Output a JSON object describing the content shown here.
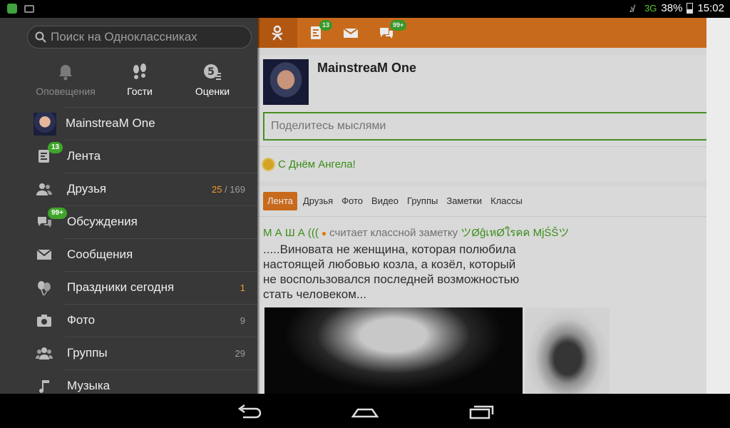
{
  "status_bar": {
    "network": "3G",
    "battery": "38%",
    "time": "15:02",
    "colors": {
      "network": "#5fc634"
    }
  },
  "drawer": {
    "search": {
      "placeholder": "Поиск на Одноклассниках"
    },
    "quick_actions": [
      {
        "label": "Оповещения",
        "icon": "bell-icon",
        "dimmed": true
      },
      {
        "label": "Гости",
        "icon": "footprints-icon",
        "dimmed": false
      },
      {
        "label": "Оценки",
        "icon": "ratings-icon",
        "dimmed": false
      }
    ],
    "items": [
      {
        "label": "MainstreaM One",
        "icon": "avatar"
      },
      {
        "label": "Лента",
        "icon": "feed-icon",
        "badge": "13"
      },
      {
        "label": "Друзья",
        "icon": "friends-icon",
        "count_highlight": "25",
        "count_rest": " / 169"
      },
      {
        "label": "Обсуждения",
        "icon": "discussions-icon",
        "badge": "99+"
      },
      {
        "label": "Сообщения",
        "icon": "mail-icon"
      },
      {
        "label": "Праздники сегодня",
        "icon": "balloons-icon",
        "count_highlight": "1"
      },
      {
        "label": "Фото",
        "icon": "camera-icon",
        "count": "9"
      },
      {
        "label": "Группы",
        "icon": "groups-icon",
        "count": "29"
      },
      {
        "label": "Музыка",
        "icon": "music-icon"
      }
    ]
  },
  "toolbar": {
    "badges": {
      "feed": "13",
      "discussions": "99+"
    },
    "colors": {
      "bar": "#d9731f",
      "active": "#c05f14",
      "badge": "#3ea52b"
    }
  },
  "profile": {
    "name": "MainstreaM One",
    "status_placeholder": "Поделитесь мыслями"
  },
  "holiday": {
    "text": "С Днём Ангела!"
  },
  "feed": {
    "tabs": [
      "Лента",
      "Друзья",
      "Фото",
      "Видео",
      "Группы",
      "Заметки",
      "Классы"
    ],
    "active_tab": "Лента",
    "post": {
      "author": "М А Ш А (((",
      "action": "считает классной заметку",
      "target": "ツØĝเหØใรคค MjŚŠツ",
      "text_lines": [
        ".....Виновата не женщина, которая полюбила",
        "настоящей любовью козла, а козёл, который",
        "не воспользовался последней возможностью",
        "стать человеком..."
      ]
    }
  }
}
